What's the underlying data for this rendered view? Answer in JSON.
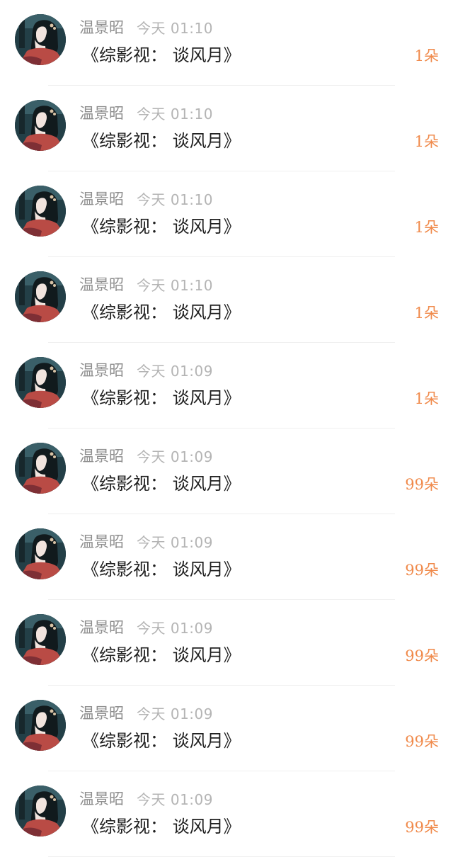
{
  "feed": {
    "items": [
      {
        "username": "温景昭",
        "time": "今天 01:10",
        "title": "《综影视： 谈风月》",
        "gift": "1朵"
      },
      {
        "username": "温景昭",
        "time": "今天 01:10",
        "title": "《综影视： 谈风月》",
        "gift": "1朵"
      },
      {
        "username": "温景昭",
        "time": "今天 01:10",
        "title": "《综影视： 谈风月》",
        "gift": "1朵"
      },
      {
        "username": "温景昭",
        "time": "今天 01:10",
        "title": "《综影视： 谈风月》",
        "gift": "1朵"
      },
      {
        "username": "温景昭",
        "time": "今天 01:09",
        "title": "《综影视： 谈风月》",
        "gift": "1朵"
      },
      {
        "username": "温景昭",
        "time": "今天 01:09",
        "title": "《综影视： 谈风月》",
        "gift": "99朵"
      },
      {
        "username": "温景昭",
        "time": "今天 01:09",
        "title": "《综影视： 谈风月》",
        "gift": "99朵"
      },
      {
        "username": "温景昭",
        "time": "今天 01:09",
        "title": "《综影视： 谈风月》",
        "gift": "99朵"
      },
      {
        "username": "温景昭",
        "time": "今天 01:09",
        "title": "《综影视： 谈风月》",
        "gift": "99朵"
      },
      {
        "username": "温景昭",
        "time": "今天 01:09",
        "title": "《综影视： 谈风月》",
        "gift": "99朵"
      }
    ]
  },
  "colors": {
    "gift_accent": "#f08a4b",
    "username_gray": "#8e8e8e",
    "time_gray": "#b4b4b4",
    "title_text": "#1f1f1f",
    "avatar_background": "#233f47"
  }
}
